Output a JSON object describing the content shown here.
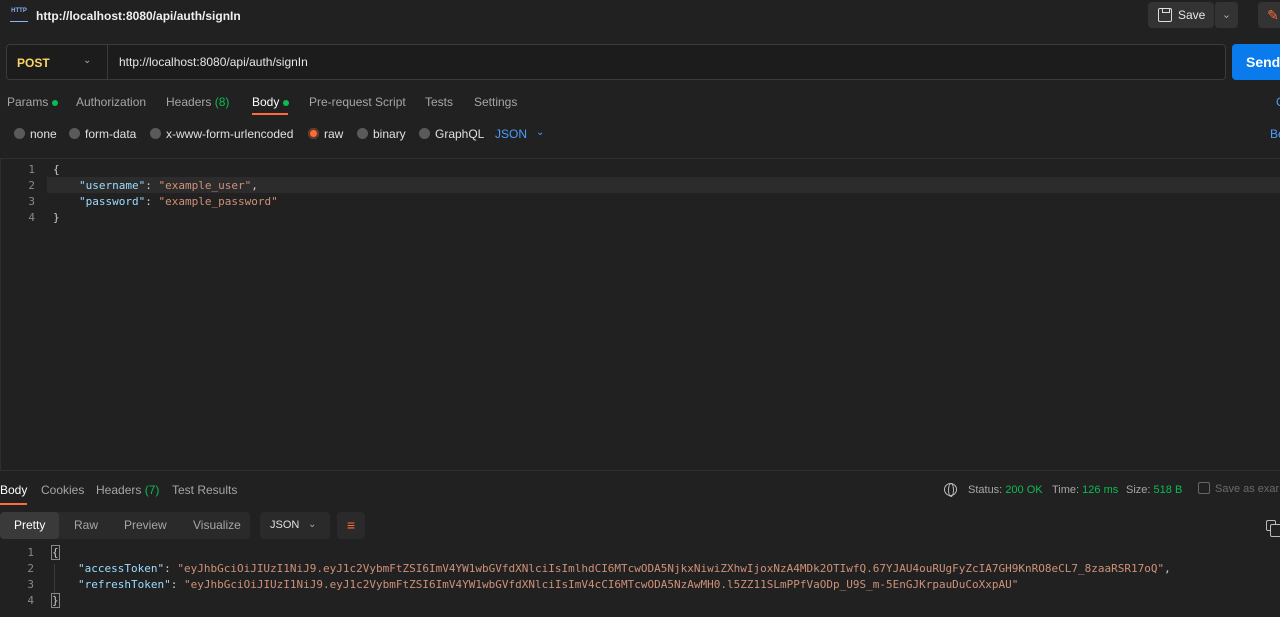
{
  "header": {
    "request_title": "http://localhost:8080/api/auth/signIn",
    "http_icon_text": "HTTP",
    "save_label": "Save",
    "icons": [
      "http-icon",
      "save-icon",
      "chevron-down-icon",
      "pencil-icon"
    ]
  },
  "url_bar": {
    "method": "POST",
    "url": "http://localhost:8080/api/auth/signIn",
    "send_label": "Send"
  },
  "request_tabs": [
    {
      "label": "Params",
      "dot": true
    },
    {
      "label": "Authorization"
    },
    {
      "label": "Headers",
      "count": "(8)"
    },
    {
      "label": "Body",
      "dot": true,
      "active": true
    },
    {
      "label": "Pre-request Script"
    },
    {
      "label": "Tests"
    },
    {
      "label": "Settings"
    }
  ],
  "cookies_link": "C",
  "body_types": [
    {
      "label": "none"
    },
    {
      "label": "form-data"
    },
    {
      "label": "x-www-form-urlencoded"
    },
    {
      "label": "raw",
      "selected": true
    },
    {
      "label": "binary"
    },
    {
      "label": "GraphQL"
    }
  ],
  "raw_format": "JSON",
  "beautify_link": "Be",
  "request_body": {
    "line_numbers": [
      "1",
      "2",
      "3",
      "4"
    ],
    "open": "{",
    "username_key": "\"username\"",
    "username_val": "\"example_user\"",
    "password_key": "\"password\"",
    "password_val": "\"example_password\"",
    "close": "}"
  },
  "response_tabs": [
    {
      "label": "Body",
      "active": true
    },
    {
      "label": "Cookies"
    },
    {
      "label": "Headers",
      "count": "(7)"
    },
    {
      "label": "Test Results"
    }
  ],
  "response_meta": {
    "status_label": "Status:",
    "status_value": "200 OK",
    "time_label": "Time:",
    "time_value": "126 ms",
    "size_label": "Size:",
    "size_value": "518 B",
    "save_example": "Save as exar"
  },
  "response_views": [
    "Pretty",
    "Raw",
    "Preview",
    "Visualize"
  ],
  "response_format": "JSON",
  "response_body": {
    "line_numbers": [
      "1",
      "2",
      "3",
      "4"
    ],
    "open": "{",
    "access_key": "\"accessToken\"",
    "access_val": "\"eyJhbGciOiJIUzI1NiJ9.eyJ1c2VybmFtZSI6ImV4YW1wbGVfdXNlciIsImlhdCI6MTcwODA5NjkxNiwiZXhwIjoxNzA4MDk2OTIwfQ.67YJAU4ouRUgFyZcIA7GH9KnRO8eCL7_8zaaRSR17oQ\"",
    "refresh_key": "\"refreshToken\"",
    "refresh_val": "\"eyJhbGciOiJIUzI1NiJ9.eyJ1c2VybmFtZSI6ImV4YW1wbGVfdXNlciIsImV4cCI6MTcwODA5NzAwMH0.l5ZZ11SLmPPfVaODp_U9S_m-5EnGJKrpauDuCoXxpAU\"",
    "close": "}"
  },
  "colors": {
    "accent": "#ff6c37",
    "send": "#097bed",
    "success": "#0cbb52",
    "method_post": "#ffd36a",
    "link": "#4a9eff"
  }
}
